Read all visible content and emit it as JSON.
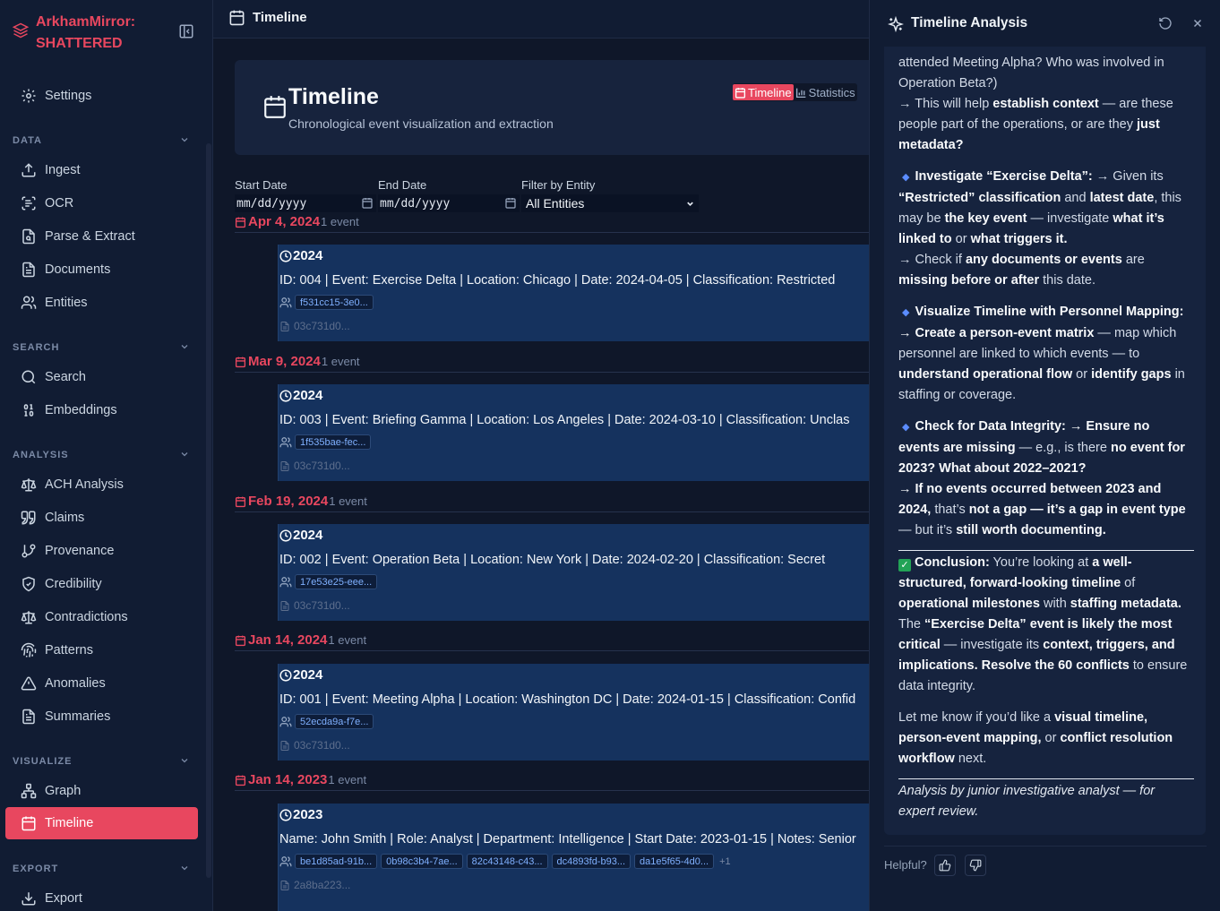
{
  "brand": {
    "line1": "ArkhamMirror:",
    "line2": "SHATTERED"
  },
  "sidebar": {
    "top_items": [
      {
        "label": "Settings",
        "icon": "gear-icon"
      }
    ],
    "sections": {
      "data": {
        "label": "DATA",
        "items": [
          "Ingest",
          "OCR",
          "Parse & Extract",
          "Documents",
          "Entities"
        ]
      },
      "search": {
        "label": "SEARCH",
        "items": [
          "Search",
          "Embeddings"
        ]
      },
      "analysis": {
        "label": "ANALYSIS",
        "items": [
          "ACH Analysis",
          "Claims",
          "Provenance",
          "Credibility",
          "Contradictions",
          "Patterns",
          "Anomalies",
          "Summaries"
        ]
      },
      "visualize": {
        "label": "VISUALIZE",
        "items": [
          "Graph",
          "Timeline"
        ]
      },
      "export": {
        "label": "EXPORT",
        "items": [
          "Export"
        ]
      }
    },
    "active": "Timeline"
  },
  "topbar": {
    "title": "Timeline"
  },
  "header": {
    "title": "Timeline",
    "subtitle": "Chronological event visualization and extraction",
    "toggle": {
      "timeline": "Timeline",
      "statistics": "Statistics"
    }
  },
  "filters": {
    "start_label": "Start Date",
    "end_label": "End Date",
    "entity_label": "Filter by Entity",
    "start_value": "mm/dd/yyyy",
    "end_value": "mm/dd/yyyy",
    "entity_value": "All Entities"
  },
  "groups": [
    {
      "date": "Apr 4, 2024",
      "count": "1 event",
      "year": "2024",
      "text": "ID: 004 | Event: Exercise Delta | Location: Chicago | Date: 2024-04-05 | Classification: Restricted",
      "entities": [
        "f531cc15-3e0..."
      ],
      "more": "",
      "doc": "03c731d0..."
    },
    {
      "date": "Mar 9, 2024",
      "count": "1 event",
      "year": "2024",
      "text": "ID: 003 | Event: Briefing Gamma | Location: Los Angeles | Date: 2024-03-10 | Classification: Unclas",
      "entities": [
        "1f535bae-fec..."
      ],
      "more": "",
      "doc": "03c731d0..."
    },
    {
      "date": "Feb 19, 2024",
      "count": "1 event",
      "year": "2024",
      "text": "ID: 002 | Event: Operation Beta | Location: New York | Date: 2024-02-20 | Classification: Secret",
      "entities": [
        "17e53e25-eee..."
      ],
      "more": "",
      "doc": "03c731d0..."
    },
    {
      "date": "Jan 14, 2024",
      "count": "1 event",
      "year": "2024",
      "text": "ID: 001 | Event: Meeting Alpha | Location: Washington DC | Date: 2024-01-15 | Classification: Confid",
      "entities": [
        "52ecda9a-f7e..."
      ],
      "more": "",
      "doc": "03c731d0..."
    },
    {
      "date": "Jan 14, 2023",
      "count": "1 event",
      "year": "2023",
      "text": "Name: John Smith | Role: Analyst | Department: Intelligence | Start Date: 2023-01-15 | Notes: Senior",
      "entities": [
        "be1d85ad-91b...",
        "0b98c3b4-7ae...",
        "82c43148-c43...",
        "dc4893fd-b93...",
        "da1e5f65-4d0..."
      ],
      "more": "+1",
      "doc": "2a8ba223..."
    }
  ],
  "panel": {
    "title": "Timeline Analysis",
    "helpful": "Helpful?",
    "colors": {
      "accent": "#e8475f",
      "card": "#15325e"
    }
  }
}
